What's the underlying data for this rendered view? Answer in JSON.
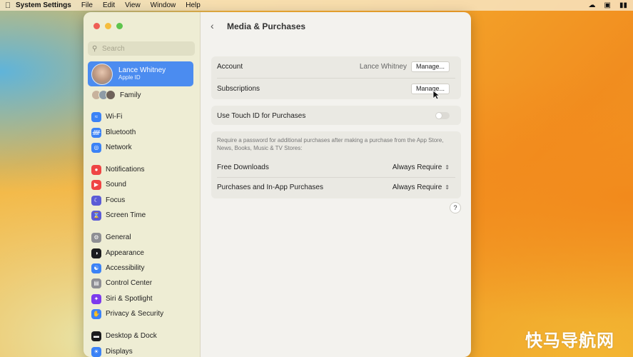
{
  "menubar": {
    "app_name": "System Settings",
    "items": [
      "File",
      "Edit",
      "View",
      "Window",
      "Help"
    ]
  },
  "sidebar": {
    "search_placeholder": "Search",
    "user": {
      "name": "Lance Whitney",
      "subtitle": "Apple ID"
    },
    "family_label": "Family",
    "items": [
      {
        "label": "Wi-Fi",
        "icon": "wifi-icon",
        "color": "#3b82f6"
      },
      {
        "label": "Bluetooth",
        "icon": "bluetooth-icon",
        "color": "#3b82f6"
      },
      {
        "label": "Network",
        "icon": "globe-icon",
        "color": "#3b82f6"
      },
      {
        "label": "Notifications",
        "icon": "bell-icon",
        "color": "#ef4444"
      },
      {
        "label": "Sound",
        "icon": "speaker-icon",
        "color": "#ef4444"
      },
      {
        "label": "Focus",
        "icon": "moon-icon",
        "color": "#5b5bd6"
      },
      {
        "label": "Screen Time",
        "icon": "hourglass-icon",
        "color": "#5b5bd6"
      },
      {
        "label": "General",
        "icon": "gear-icon",
        "color": "#8e8e93"
      },
      {
        "label": "Appearance",
        "icon": "appearance-icon",
        "color": "#1c1c1e"
      },
      {
        "label": "Accessibility",
        "icon": "accessibility-icon",
        "color": "#3b82f6"
      },
      {
        "label": "Control Center",
        "icon": "control-center-icon",
        "color": "#8e8e93"
      },
      {
        "label": "Siri & Spotlight",
        "icon": "siri-icon",
        "color": "#7c3aed"
      },
      {
        "label": "Privacy & Security",
        "icon": "hand-icon",
        "color": "#3b82f6"
      },
      {
        "label": "Desktop & Dock",
        "icon": "dock-icon",
        "color": "#1c1c1e"
      },
      {
        "label": "Displays",
        "icon": "display-icon",
        "color": "#3b82f6"
      }
    ]
  },
  "content": {
    "title": "Media & Purchases",
    "account": {
      "label": "Account",
      "value": "Lance Whitney",
      "button": "Manage..."
    },
    "subscriptions": {
      "label": "Subscriptions",
      "button": "Manage..."
    },
    "touch_id": {
      "label": "Use Touch ID for Purchases",
      "enabled": false
    },
    "note": "Require a password for additional purchases after making a purchase from the App Store, News, Books, Music & TV Stores:",
    "free_downloads": {
      "label": "Free Downloads",
      "value": "Always Require"
    },
    "in_app": {
      "label": "Purchases and In-App Purchases",
      "value": "Always Require"
    },
    "help": "?"
  },
  "watermark": "快马导航网"
}
